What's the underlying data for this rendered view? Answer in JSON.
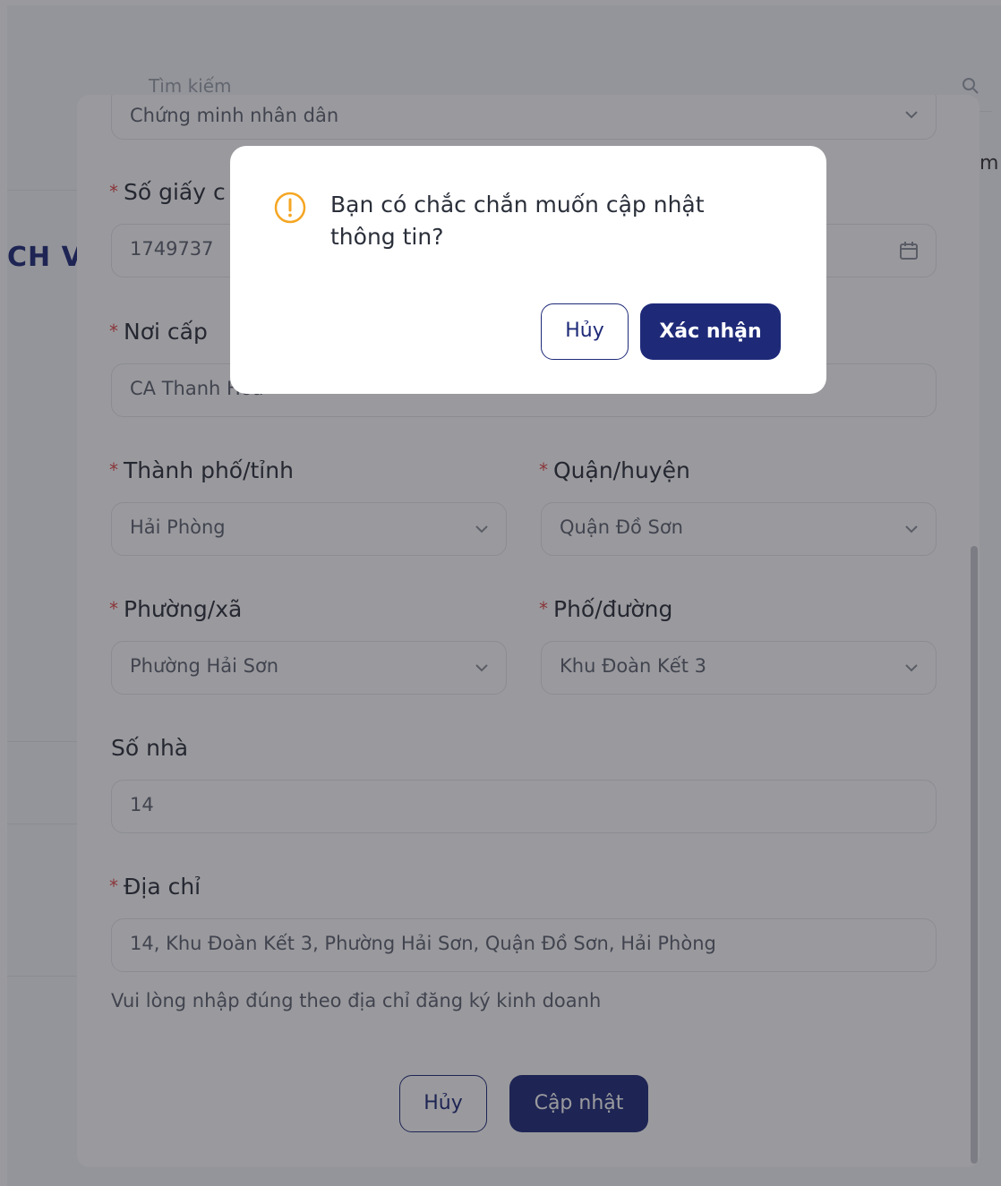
{
  "background": {
    "search_placeholder": "Tìm kiếm",
    "title_fragment": "CH VỤ",
    "right_fragment": "m"
  },
  "form": {
    "id_type": {
      "value": "Chứng minh nhân dân"
    },
    "id_number": {
      "label": "Số giấy c",
      "value": "1749737"
    },
    "issued_by": {
      "label": "Nơi cấp",
      "value": "CA Thanh Hóa"
    },
    "city": {
      "label": "Thành phố/tỉnh",
      "value": "Hải Phòng"
    },
    "district": {
      "label": "Quận/huyện",
      "value": "Quận Đồ Sơn"
    },
    "ward": {
      "label": "Phường/xã",
      "value": "Phường Hải Sơn"
    },
    "street": {
      "label": "Phố/đường",
      "value": "Khu Đoàn Kết 3"
    },
    "house_number": {
      "label": "Số nhà",
      "value": "14"
    },
    "address": {
      "label": "Địa chỉ",
      "value": "14, Khu Đoàn Kết 3, Phường Hải Sơn, Quận Đồ Sơn, Hải Phòng"
    },
    "hint": "Vui lòng nhập đúng theo địa chỉ đăng ký kinh doanh",
    "required_mark": "*",
    "cancel_label": "Hủy",
    "update_label": "Cập nhật"
  },
  "confirm_dialog": {
    "message": "Bạn có chắc chắn muốn cập nhật thông tin?",
    "cancel_label": "Hủy",
    "confirm_label": "Xác nhận",
    "icon": "warning-circle-icon",
    "accent_color": "#f5a623",
    "primary_color": "#1e2a78"
  }
}
